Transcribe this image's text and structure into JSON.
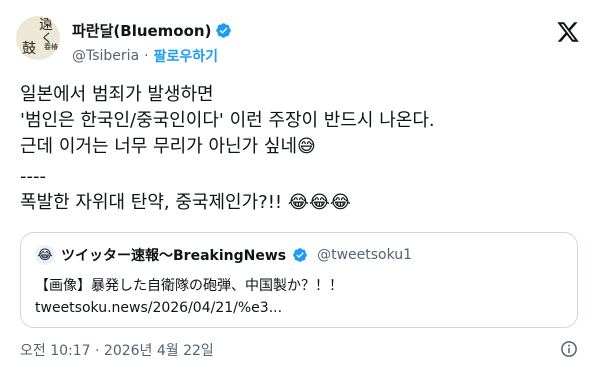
{
  "author": {
    "avatar_text": [
      "遠",
      "く",
      "鼓",
      "春",
      "椿"
    ],
    "display_name": "파란달(Bluemoon)",
    "handle": "@Tsiberia",
    "separator": "·",
    "follow_label": "팔로우하기"
  },
  "post": {
    "lines": [
      "일본에서 범죄가 발생하면",
      "'범인은 한국인/중국인이다' 이런 주장이 반드시 나온다.",
      "근데 이거는 너무 무리가 아닌가 싶네😅",
      "----",
      "폭발한 자위대 탄약, 중국제인가?!! 😂😂😂"
    ]
  },
  "quote": {
    "avatar_icon": "😂",
    "display_name": "ツイッター速報〜BreakingNews",
    "handle": "@tweetsoku1",
    "text_line1": "【画像】暴発した自衛隊の砲弾、中国製か？！！",
    "text_line2": "tweetsoku.news/2026/04/21/%e3..."
  },
  "meta": {
    "timestamp": "오전 10:17 · 2026년 4월 22일"
  },
  "icons": {
    "verified": "verified-badge-icon",
    "logo": "x-logo-icon",
    "info": "info-icon"
  },
  "colors": {
    "accent": "#1d9bf0",
    "text": "#0f1419",
    "muted": "#536471",
    "border": "#cfd9de"
  }
}
